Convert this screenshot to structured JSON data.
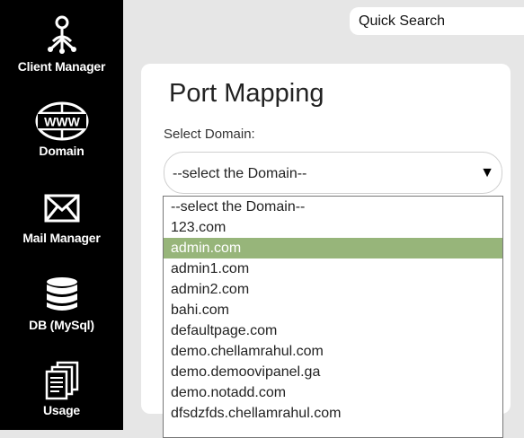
{
  "sidebar": {
    "items": [
      {
        "label": "Client Manager",
        "icon": "client-manager-icon"
      },
      {
        "label": "Domain",
        "icon": "www-icon"
      },
      {
        "label": "Mail Manager",
        "icon": "envelope-icon"
      },
      {
        "label": "DB (MySql)",
        "icon": "database-icon"
      },
      {
        "label": "Usage",
        "icon": "documents-icon"
      }
    ]
  },
  "search": {
    "label": "Quick Search"
  },
  "main": {
    "title": "Port Mapping",
    "field_label": "Select Domain:",
    "select_value": "--select the Domain--",
    "arrow": "▼",
    "options": [
      "--select the Domain--",
      "123.com",
      "admin.com",
      "admin1.com",
      "admin2.com",
      "bahi.com",
      "defaultpage.com",
      "demo.chellamrahul.com",
      "demo.demoovipanel.ga",
      "demo.notadd.com",
      "dfsdzfds.chellamrahul.com"
    ],
    "highlighted_option": "admin.com"
  },
  "colors": {
    "sidebar_bg": "#000000",
    "page_bg": "#e6e6e6",
    "highlight": "#97b57a"
  }
}
